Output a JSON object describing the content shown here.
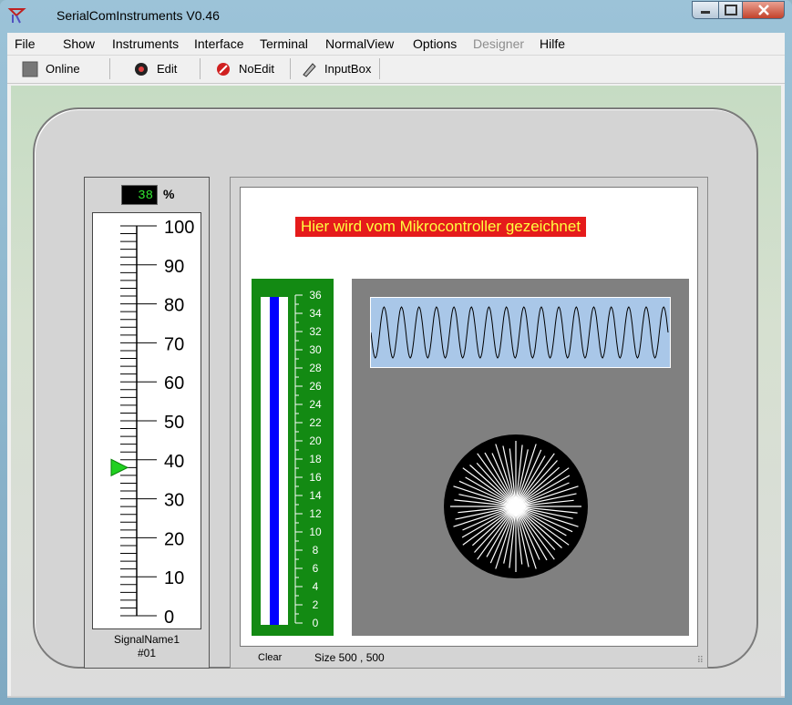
{
  "window": {
    "title": "SerialComInstruments  V0.46"
  },
  "menu": [
    "File",
    "Show",
    "Instruments",
    "Interface",
    "Terminal",
    "NormalView",
    "Options",
    "Designer",
    "Hilfe"
  ],
  "toolbar": {
    "online": "Online",
    "edit": "Edit",
    "noedit": "NoEdit",
    "inputbox": "InputBox"
  },
  "meter": {
    "value": "38",
    "unit": "%",
    "level_percent": 38,
    "scale_labels": [
      "100",
      "90",
      "80",
      "70",
      "60",
      "50",
      "40",
      "30",
      "20",
      "10",
      "0"
    ],
    "signal_name": "SignalName1",
    "channel": "#01"
  },
  "panel": {
    "banner": "Hier wird vom Mikrocontroller gezeichnet",
    "bar_scale_labels": [
      "36",
      "34",
      "32",
      "30",
      "28",
      "26",
      "24",
      "22",
      "20",
      "18",
      "16",
      "14",
      "12",
      "10",
      "8",
      "6",
      "4",
      "2",
      "0"
    ],
    "clear_label": "Clear",
    "size_label": "Size 500 , 500"
  },
  "colors": {
    "banner_bg": "#e51b1b",
    "banner_text": "#ffff40",
    "bar_panel": "#138a13",
    "bar_fill": "#0000ff",
    "wave_bg": "#a9c7e8",
    "lcd_text": "#32e832",
    "pointer": "#20d020"
  }
}
